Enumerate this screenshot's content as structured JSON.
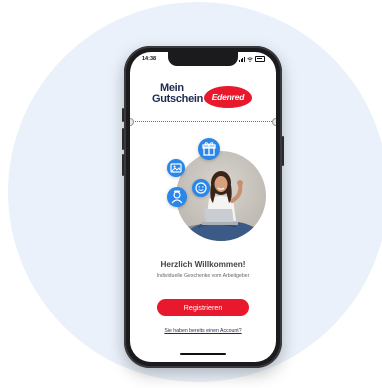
{
  "status_bar": {
    "time": "14:38"
  },
  "logo": {
    "line1": "Mein",
    "line2": "Gutschein",
    "brand": "Edenred"
  },
  "welcome": {
    "title": "Herzlich Willkommen!",
    "subtitle": "Individuelle Geschenke vom Arbeitgeber"
  },
  "actions": {
    "register_label": "Registrieren",
    "account_link": "Sie haben bereits einen Account?"
  },
  "icons": {
    "hero_icons": [
      "gift-icon",
      "image-icon",
      "smiley-icon",
      "person-icon"
    ]
  },
  "colors": {
    "brand_red": "#e8192c",
    "navy": "#1f2a52",
    "icon_blue": "#2a86e8",
    "background_circle": "#eaf1fa"
  }
}
